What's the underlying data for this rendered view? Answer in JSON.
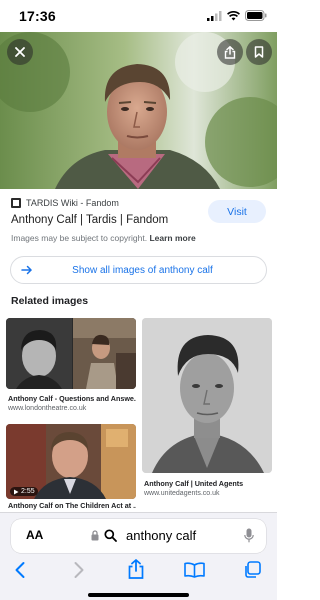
{
  "status_bar": {
    "time": "17:36"
  },
  "result": {
    "source_name": "TARDIS Wiki - Fandom",
    "title": "Anthony Calf | Tardis | Fandom",
    "visit_label": "Visit",
    "copyright_text": "Images may be subject to copyright.",
    "learn_more": "Learn more"
  },
  "show_all_label": "Show all images of anthony calf",
  "related": {
    "heading": "Related images",
    "items": [
      {
        "caption": "Anthony Calf - Questions and Answe...",
        "source": "www.londontheatre.co.uk"
      },
      {
        "caption": "Anthony Calf | United Agents",
        "source": "www.unitedagents.co.uk"
      },
      {
        "caption": "Anthony Calf on The Children Act at ...",
        "source": "",
        "duration": "2:55"
      }
    ]
  },
  "address_bar": {
    "aa_label": "AA",
    "query": "anthony calf"
  },
  "colors": {
    "accent": "#1a73e8",
    "visit_bg": "#e8f0fe",
    "chrome_bg": "#f2f2f7"
  },
  "icons": [
    "signal-icon",
    "wifi-icon",
    "battery-icon",
    "close-icon",
    "share-icon",
    "bookmark-icon",
    "arrow-right-icon",
    "play-icon",
    "lock-icon",
    "search-icon",
    "mic-icon",
    "back-icon",
    "forward-icon",
    "bookmarks-icon",
    "tabs-icon"
  ]
}
